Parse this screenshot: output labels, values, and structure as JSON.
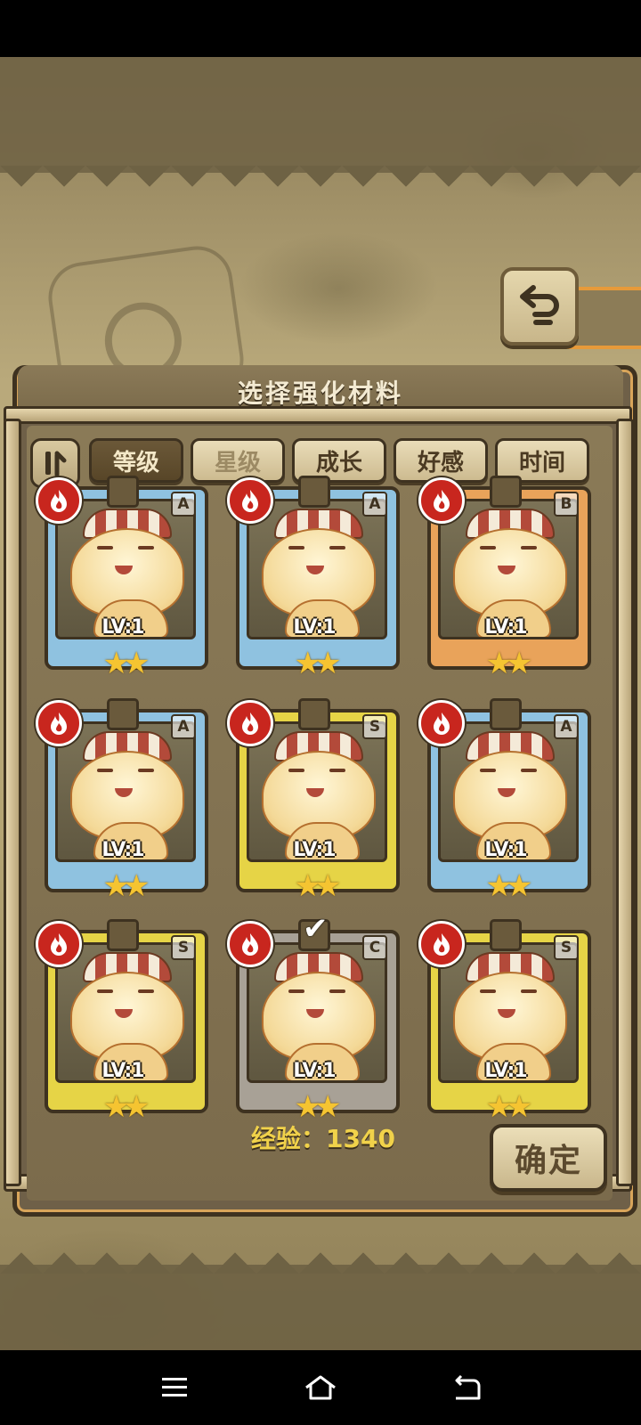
{
  "panel": {
    "title": "选择强化材料"
  },
  "sort_tabs": [
    {
      "label": "等级",
      "active": true
    },
    {
      "label": "星级",
      "active": false
    },
    {
      "label": "成长",
      "active": false
    },
    {
      "label": "好感",
      "active": false
    },
    {
      "label": "时间",
      "active": false
    }
  ],
  "cards": [
    {
      "rank": "A",
      "level": "LV:1",
      "stars": 2,
      "selected": false
    },
    {
      "rank": "A",
      "level": "LV:1",
      "stars": 2,
      "selected": false
    },
    {
      "rank": "B",
      "level": "LV:1",
      "stars": 2,
      "selected": false
    },
    {
      "rank": "A",
      "level": "LV:1",
      "stars": 2,
      "selected": false
    },
    {
      "rank": "S",
      "level": "LV:1",
      "stars": 2,
      "selected": false
    },
    {
      "rank": "A",
      "level": "LV:1",
      "stars": 2,
      "selected": false
    },
    {
      "rank": "S",
      "level": "LV:1",
      "stars": 2,
      "selected": false
    },
    {
      "rank": "C",
      "level": "LV:1",
      "stars": 2,
      "selected": true
    },
    {
      "rank": "S",
      "level": "LV:1",
      "stars": 2,
      "selected": false
    }
  ],
  "footer": {
    "exp_text": "经验：1340",
    "confirm_label": "确定"
  },
  "icons": {
    "back": "return-arrow-icon",
    "sort": "sort-order-icon",
    "element": "fire-element-icon",
    "nav_menu": "menu-icon",
    "nav_home": "home-icon",
    "nav_back": "back-icon"
  },
  "colors": {
    "rank_A": "#8fc2e0",
    "rank_B": "#e9a35a",
    "rank_S": "#e6d446",
    "rank_C": "#a8a196",
    "fire": "#c8261e",
    "exp": "#f1d24a"
  }
}
